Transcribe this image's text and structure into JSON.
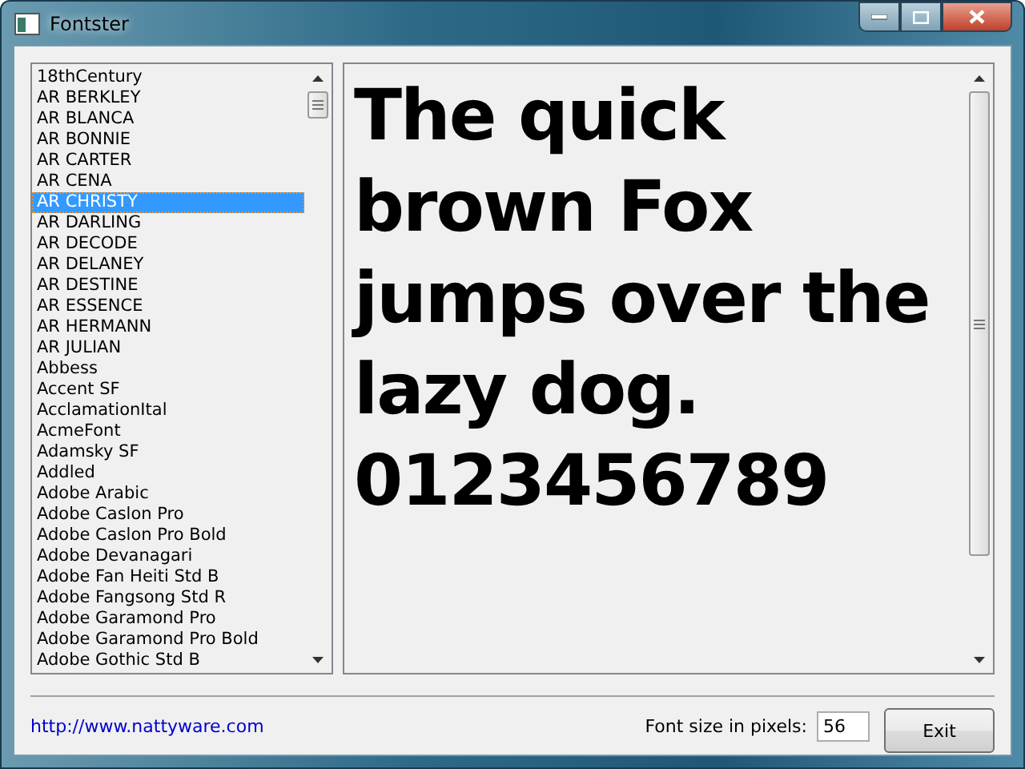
{
  "window": {
    "title": "Fontster"
  },
  "font_list": {
    "items": [
      {
        "label": "18thCentury",
        "selected": false
      },
      {
        "label": "AR BERKLEY",
        "selected": false
      },
      {
        "label": "AR BLANCA",
        "selected": false
      },
      {
        "label": "AR BONNIE",
        "selected": false
      },
      {
        "label": "AR CARTER",
        "selected": false
      },
      {
        "label": "AR CENA",
        "selected": false
      },
      {
        "label": "AR CHRISTY",
        "selected": true
      },
      {
        "label": "AR DARLING",
        "selected": false
      },
      {
        "label": "AR DECODE",
        "selected": false
      },
      {
        "label": "AR DELANEY",
        "selected": false
      },
      {
        "label": "AR DESTINE",
        "selected": false
      },
      {
        "label": "AR ESSENCE",
        "selected": false
      },
      {
        "label": "AR HERMANN",
        "selected": false
      },
      {
        "label": "AR JULIAN",
        "selected": false
      },
      {
        "label": "Abbess",
        "selected": false
      },
      {
        "label": "Accent SF",
        "selected": false
      },
      {
        "label": "AcclamationItal",
        "selected": false
      },
      {
        "label": "AcmeFont",
        "selected": false
      },
      {
        "label": "Adamsky SF",
        "selected": false
      },
      {
        "label": "Addled",
        "selected": false
      },
      {
        "label": "Adobe Arabic",
        "selected": false
      },
      {
        "label": "Adobe Caslon Pro",
        "selected": false
      },
      {
        "label": "Adobe Caslon Pro Bold",
        "selected": false
      },
      {
        "label": "Adobe Devanagari",
        "selected": false
      },
      {
        "label": "Adobe Fan Heiti Std B",
        "selected": false
      },
      {
        "label": "Adobe Fangsong Std R",
        "selected": false
      },
      {
        "label": "Adobe Garamond Pro",
        "selected": false
      },
      {
        "label": "Adobe Garamond Pro Bold",
        "selected": false
      },
      {
        "label": "Adobe Gothic Std B",
        "selected": false
      }
    ]
  },
  "preview": {
    "lines": [
      "The quick",
      "brown Fox",
      "jumps over the",
      "lazy dog.",
      "0123456789"
    ]
  },
  "footer": {
    "link": "http://www.nattyware.com",
    "font_size_label": "Font size in pixels:",
    "font_size_value": "56",
    "exit_button": "Exit"
  }
}
